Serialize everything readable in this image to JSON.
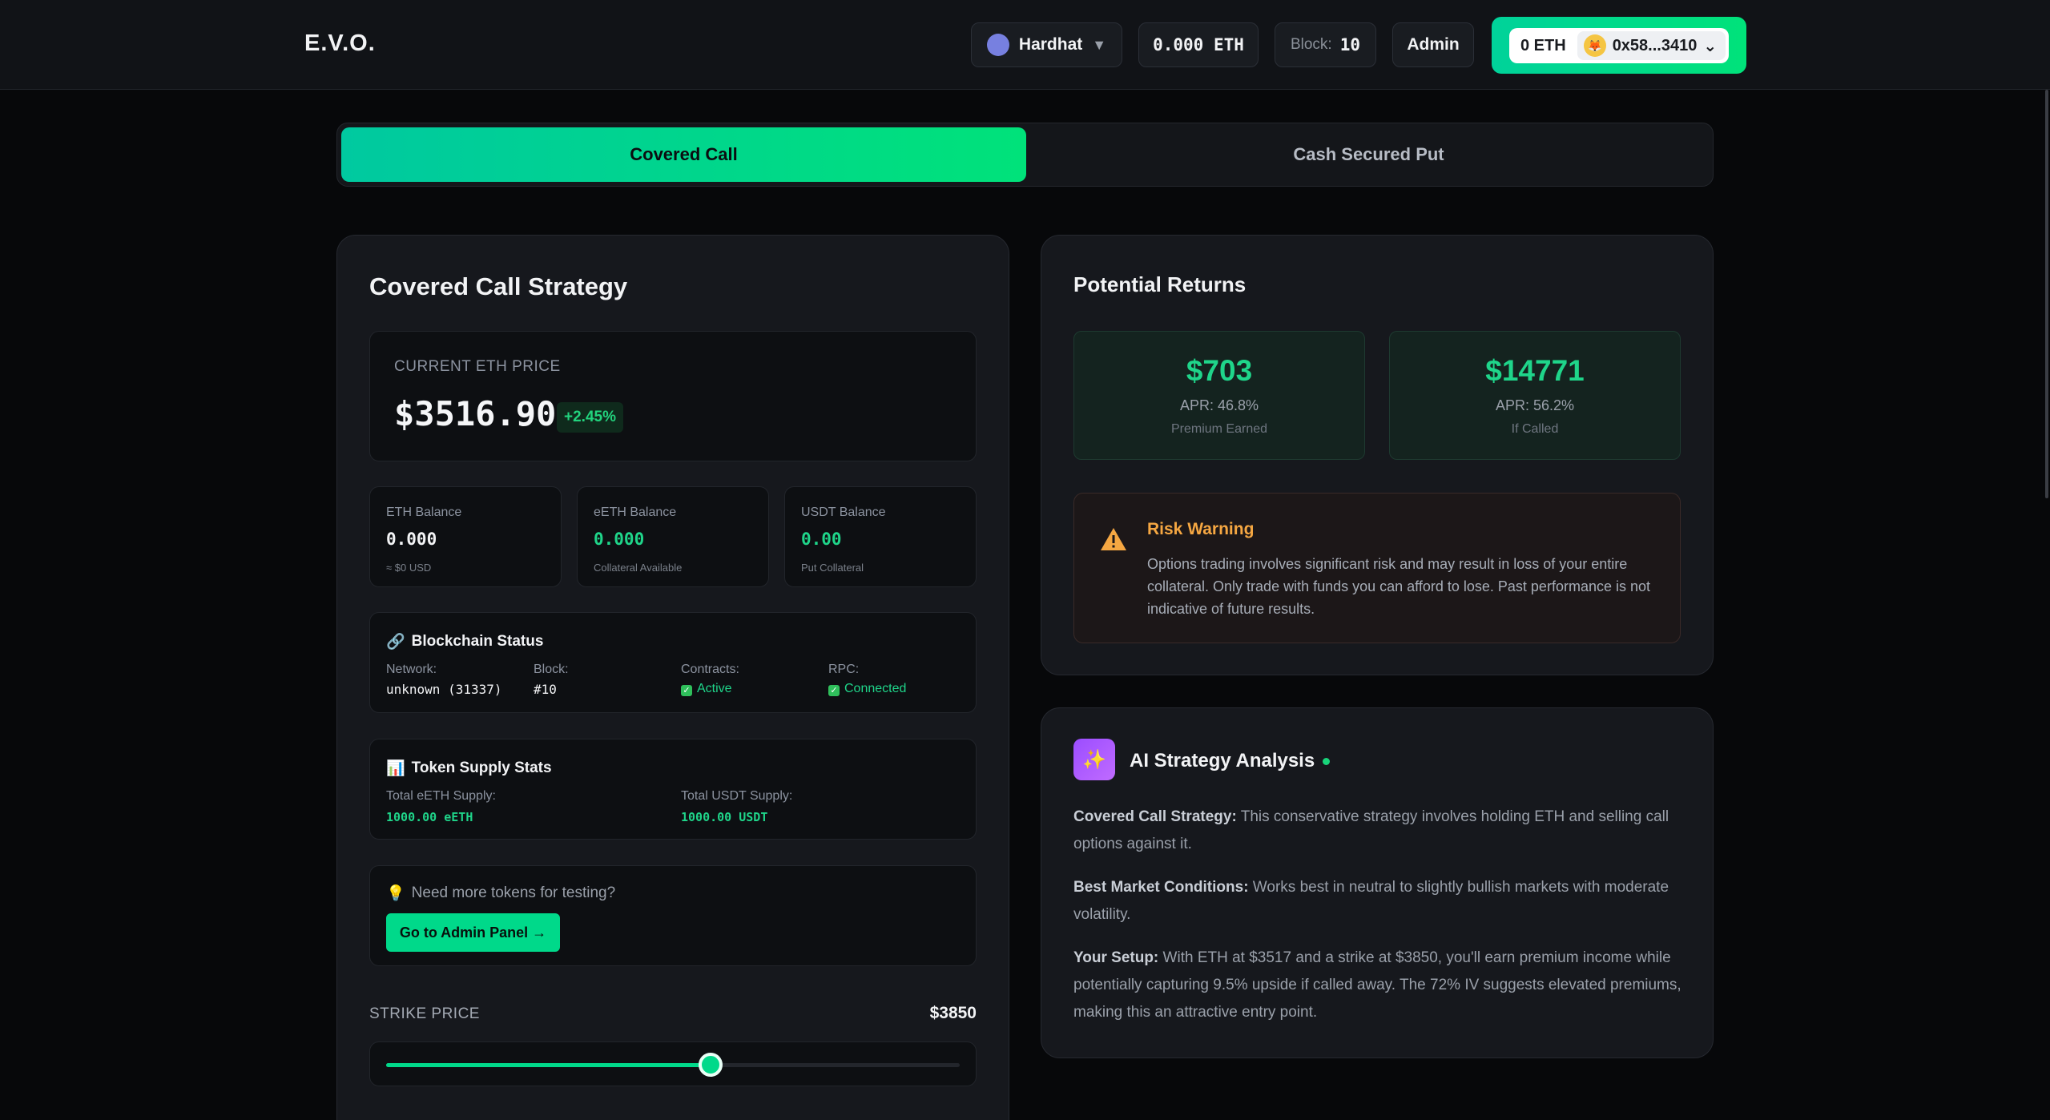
{
  "header": {
    "logo": "E.V.O.",
    "network": "Hardhat",
    "network_caret": "▼",
    "eth_balance": "0.000 ETH",
    "block_label": "Block:",
    "block_value": "10",
    "admin_label": "Admin",
    "wallet": {
      "eth": "0 ETH",
      "address": "0x58...3410",
      "caret": "⌄"
    }
  },
  "tabs": [
    {
      "label": "Covered Call",
      "active": true
    },
    {
      "label": "Cash Secured Put",
      "active": false
    }
  ],
  "strategy": {
    "title": "Covered Call Strategy",
    "price_label": "CURRENT ETH PRICE",
    "price": "$3516.90",
    "change": "+2.45%",
    "balances": [
      {
        "label": "ETH Balance",
        "value": "0.000",
        "sub": "≈ $0 USD"
      },
      {
        "label": "eETH Balance",
        "value": "0.000",
        "sub": "Collateral Available"
      },
      {
        "label": "USDT Balance",
        "value": "0.00",
        "sub": "Put Collateral"
      }
    ],
    "blockchain": {
      "icon": "🔗",
      "title": "Blockchain Status",
      "network_label": "Network:",
      "network_value": "unknown (31337)",
      "block_label": "Block:",
      "block_value": "#10",
      "contracts_label": "Contracts:",
      "contracts_value": "Active",
      "rpc_label": "RPC:",
      "rpc_value": "Connected"
    },
    "supply": {
      "icon": "📊",
      "title": "Token Supply Stats",
      "eeth_label": "Total eETH Supply:",
      "eeth_value": "1000.00 eETH",
      "usdt_label": "Total USDT Supply:",
      "usdt_value": "1000.00 USDT"
    },
    "testing": {
      "icon": "💡",
      "question": "Need more tokens for testing?",
      "button": "Go to Admin Panel →"
    },
    "strike": {
      "label": "STRIKE PRICE",
      "value": "$3850",
      "slider_fraction": 0.565
    }
  },
  "returns": {
    "title": "Potential Returns",
    "cards": [
      {
        "amount": "$703",
        "apr": "APR: 46.8%",
        "sub": "Premium Earned"
      },
      {
        "amount": "$14771",
        "apr": "APR: 56.2%",
        "sub": "If Called"
      }
    ],
    "warning": {
      "title": "Risk Warning",
      "text": "Options trading involves significant risk and may result in loss of your entire collateral. Only trade with funds you can afford to lose. Past performance is not indicative of future results."
    }
  },
  "ai": {
    "icon": "✨",
    "title": "AI Strategy Analysis",
    "paragraphs": [
      {
        "label": "Covered Call Strategy:",
        "text": " This conservative strategy involves holding ETH and selling call options against it."
      },
      {
        "label": "Best Market Conditions:",
        "text": " Works best in neutral to slightly bullish markets with moderate volatility."
      },
      {
        "label": "Your Setup:",
        "text": " With ETH at $3517 and a strike at $3850, you'll earn premium income while potentially capturing 9.5% upside if called away. The 72% IV suggests elevated premiums, making this an attractive entry point."
      }
    ]
  },
  "colors": {
    "accent": "#00d98a",
    "warning": "#f5a742",
    "background": "#07080a"
  }
}
